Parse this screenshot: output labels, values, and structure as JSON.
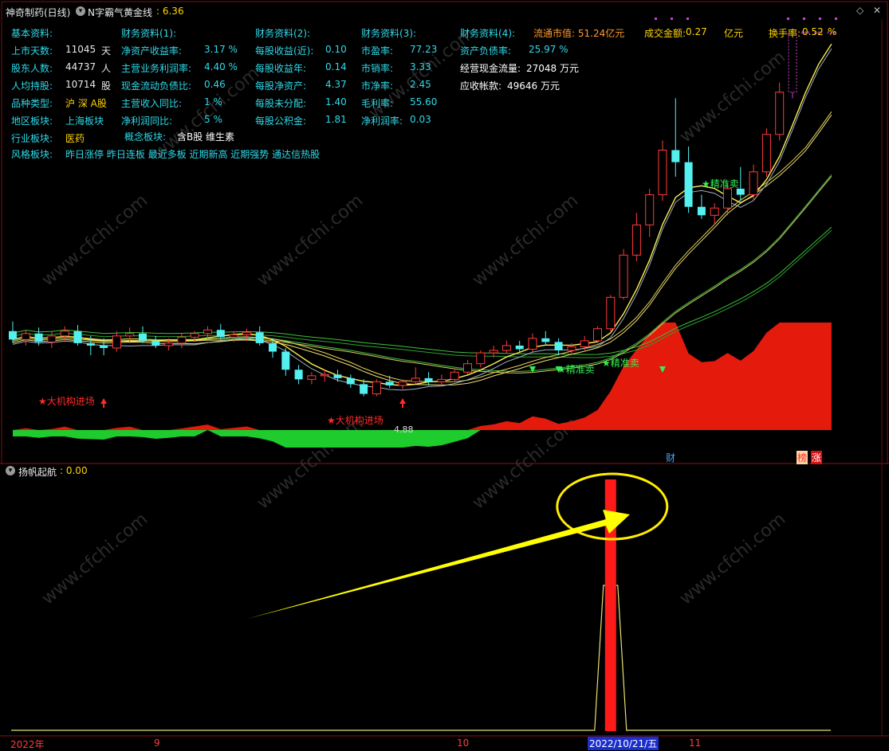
{
  "header": {
    "stock": "神奇制药(日线)",
    "indicator": "N字霸气黄金线",
    "indicator_value": ": 6.36"
  },
  "info_panel": {
    "basic_title": "基本资料:",
    "basic": [
      {
        "label": "上市天数:",
        "value": "11045",
        "unit": "天"
      },
      {
        "label": "股东人数:",
        "value": "44737",
        "unit": "人"
      },
      {
        "label": "人均持股:",
        "value": "10714",
        "unit": "股"
      },
      {
        "label": "品种类型:",
        "value": "沪 深 A股",
        "unit": ""
      },
      {
        "label": "地区板块:",
        "value": "上海板块",
        "unit": ""
      },
      {
        "label": "行业板块:",
        "value": "医药",
        "unit": ""
      }
    ],
    "concept_label": "概念板块:",
    "concept_value": "含B股 维生素",
    "style_label": "风格板块:",
    "style_value": "昨日涨停 昨日连板 最近多板 近期新高 近期强势 通达信热股",
    "fin1_title": "财务资料(1):",
    "fin1": [
      {
        "label": "净资产收益率:",
        "value": "3.17 %"
      },
      {
        "label": "主营业务利润率:",
        "value": "4.40 %"
      },
      {
        "label": "现金流动负债比:",
        "value": "0.46"
      },
      {
        "label": "主营收入同比:",
        "value": "1 %"
      },
      {
        "label": "净利润同比:",
        "value": "5 %"
      }
    ],
    "fin2_title": "财务资料(2):",
    "fin2": [
      {
        "label": "每股收益(近):",
        "value": "0.10"
      },
      {
        "label": "每股收益年:",
        "value": "0.14"
      },
      {
        "label": "每股净资产:",
        "value": "4.37"
      },
      {
        "label": "每股未分配:",
        "value": "1.40"
      },
      {
        "label": "每股公积金:",
        "value": "1.81"
      }
    ],
    "fin3_title": "财务资料(3):",
    "fin3": [
      {
        "label": "市盈率:",
        "value": "77.23"
      },
      {
        "label": "市销率:",
        "value": "3.33"
      },
      {
        "label": "市净率:",
        "value": "2.45"
      },
      {
        "label": "毛利率:",
        "value": "55.60"
      },
      {
        "label": "净利润率:",
        "value": "0.03"
      }
    ],
    "fin4_title": "财务资料(4):",
    "fin4": [
      {
        "label": "资产负债率:",
        "value": "25.97 %"
      },
      {
        "label": "经营现金流量:",
        "value": "27048 万元"
      },
      {
        "label": "应收帐款:",
        "value": "49646 万元"
      }
    ],
    "market_cap": "流通市值: 51.24亿元",
    "turnover_amount_label": "成交金额:",
    "turnover_amount_value": "0.27",
    "turnover_amount_unit": "亿元",
    "turnover_rate_label": "换手率:",
    "turnover_rate_value": "0.52",
    "turnover_rate_unit": "%"
  },
  "annotations": {
    "inst_entry": "★大机构进场",
    "precise_sell": "★精准卖",
    "low_price": "4.88",
    "badge_cai": "财",
    "badge_bang": "榜",
    "badge_zhang": "涨"
  },
  "sub_panel": {
    "title": "扬帆起航",
    "value": ": 0.00"
  },
  "time_axis": {
    "labels": [
      "2022年",
      "9",
      "10",
      "2022/10/21/五",
      "11"
    ]
  },
  "watermark": "www.cfchi.com",
  "colors": {
    "background": "#000000",
    "up": "#ff3b3b",
    "down": "#54f0f0",
    "signal": "#ff1a1a",
    "arrow": "#ffff00",
    "bull_area": "#e31a0c",
    "bear_area": "#1fcc2e",
    "label": "#30d9e8",
    "grid": "#7a1010"
  },
  "chart_data": [
    {
      "type": "candlestick",
      "title": "神奇制药(日线)",
      "ylim": [
        4.6,
        7.9
      ],
      "annotated_low": 4.88,
      "series": [
        {
          "name": "N字霸气黄金线",
          "last": 6.36
        }
      ],
      "ohlc": [
        [
          5.42,
          5.5,
          5.32,
          5.35
        ],
        [
          5.35,
          5.43,
          5.3,
          5.4
        ],
        [
          5.4,
          5.45,
          5.3,
          5.33
        ],
        [
          5.33,
          5.42,
          5.28,
          5.38
        ],
        [
          5.38,
          5.46,
          5.33,
          5.42
        ],
        [
          5.42,
          5.47,
          5.3,
          5.32
        ],
        [
          5.32,
          5.38,
          5.22,
          5.3
        ],
        [
          5.3,
          5.36,
          5.22,
          5.28
        ],
        [
          5.28,
          5.42,
          5.25,
          5.38
        ],
        [
          5.38,
          5.45,
          5.32,
          5.4
        ],
        [
          5.4,
          5.46,
          5.32,
          5.34
        ],
        [
          5.34,
          5.38,
          5.28,
          5.3
        ],
        [
          5.3,
          5.36,
          5.26,
          5.32
        ],
        [
          5.32,
          5.4,
          5.28,
          5.37
        ],
        [
          5.37,
          5.42,
          5.33,
          5.4
        ],
        [
          5.4,
          5.46,
          5.36,
          5.43
        ],
        [
          5.43,
          5.48,
          5.35,
          5.37
        ],
        [
          5.37,
          5.42,
          5.33,
          5.39
        ],
        [
          5.39,
          5.44,
          5.35,
          5.41
        ],
        [
          5.41,
          5.46,
          5.3,
          5.32
        ],
        [
          5.32,
          5.36,
          5.2,
          5.25
        ],
        [
          5.25,
          5.28,
          5.05,
          5.1
        ],
        [
          5.1,
          5.14,
          4.98,
          5.02
        ],
        [
          5.02,
          5.08,
          4.98,
          5.05
        ],
        [
          5.05,
          5.1,
          5.0,
          5.06
        ],
        [
          5.06,
          5.1,
          5.0,
          5.03
        ],
        [
          5.03,
          5.06,
          4.95,
          4.98
        ],
        [
          4.98,
          5.02,
          4.88,
          4.9
        ],
        [
          4.9,
          5.02,
          4.88,
          5.0
        ],
        [
          5.0,
          5.05,
          4.95,
          4.97
        ],
        [
          4.97,
          5.02,
          4.94,
          5.0
        ],
        [
          5.0,
          5.12,
          4.98,
          5.03
        ],
        [
          5.03,
          5.08,
          4.97,
          5.0
        ],
        [
          5.0,
          5.06,
          4.96,
          5.02
        ],
        [
          5.02,
          5.1,
          5.0,
          5.08
        ],
        [
          5.08,
          5.18,
          5.06,
          5.15
        ],
        [
          5.15,
          5.26,
          5.12,
          5.24
        ],
        [
          5.24,
          5.3,
          5.2,
          5.26
        ],
        [
          5.26,
          5.34,
          5.24,
          5.3
        ],
        [
          5.3,
          5.34,
          5.24,
          5.27
        ],
        [
          5.27,
          5.4,
          5.25,
          5.36
        ],
        [
          5.36,
          5.42,
          5.3,
          5.33
        ],
        [
          5.33,
          5.36,
          5.22,
          5.26
        ],
        [
          5.26,
          5.32,
          5.22,
          5.29
        ],
        [
          5.29,
          5.38,
          5.26,
          5.34
        ],
        [
          5.34,
          5.46,
          5.32,
          5.44
        ],
        [
          5.44,
          5.72,
          5.42,
          5.7
        ],
        [
          5.7,
          6.1,
          5.68,
          6.05
        ],
        [
          6.05,
          6.4,
          6.0,
          6.3
        ],
        [
          6.3,
          6.6,
          6.2,
          6.55
        ],
        [
          6.55,
          7.0,
          6.5,
          6.92
        ],
        [
          6.92,
          7.35,
          6.7,
          6.82
        ],
        [
          6.82,
          6.95,
          6.4,
          6.45
        ],
        [
          6.45,
          6.55,
          6.35,
          6.38
        ],
        [
          6.38,
          6.48,
          6.3,
          6.44
        ],
        [
          6.44,
          6.65,
          6.38,
          6.6
        ],
        [
          6.6,
          6.78,
          6.5,
          6.55
        ],
        [
          6.55,
          6.8,
          6.5,
          6.74
        ],
        [
          6.74,
          7.1,
          6.7,
          7.05
        ],
        [
          7.05,
          7.48,
          7.0,
          7.4
        ],
        [
          7.4,
          7.9,
          7.35,
          7.9
        ],
        [
          7.9,
          7.9,
          7.9,
          7.9
        ],
        [
          7.9,
          7.9,
          7.9,
          7.9
        ],
        [
          7.9,
          7.9,
          7.9,
          7.9
        ]
      ],
      "signals": {
        "inst_entry": [
          7,
          30
        ],
        "precise_sell": [
          40,
          42,
          50
        ]
      }
    },
    {
      "type": "bar",
      "title": "扬帆起航",
      "value": 0.0,
      "signal_date": "2022/10/21",
      "signal_index": 46
    }
  ]
}
